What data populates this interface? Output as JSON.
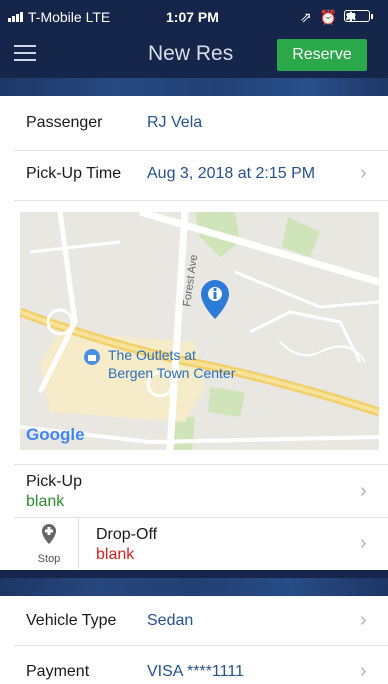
{
  "status_bar": {
    "carrier": "T-Mobile  LTE",
    "time": "1:07 PM",
    "icons": "⇗ ⏰ ✱"
  },
  "header": {
    "title": "New Res",
    "reserve_label": "Reserve",
    "accent": "#2aa84a",
    "background": "#16264a"
  },
  "passenger": {
    "label": "Passenger",
    "value": "RJ Vela"
  },
  "pickup_time": {
    "label": "Pick-Up Time",
    "value": "Aug 3, 2018 at 2:15 PM"
  },
  "map": {
    "street_label": "Forest Ave",
    "poi_label_line1": "The Outlets at",
    "poi_label_line2": "Bergen Town Center",
    "logo": "Google"
  },
  "pickup": {
    "label": "Pick-Up",
    "value": "blank"
  },
  "dropoff": {
    "label": "Drop-Off",
    "value": "blank",
    "stop_label": "Stop"
  },
  "vehicle": {
    "label": "Vehicle Type",
    "value": "Sedan"
  },
  "payment": {
    "label": "Payment",
    "value": "VISA ****1111"
  },
  "chevron": "›"
}
